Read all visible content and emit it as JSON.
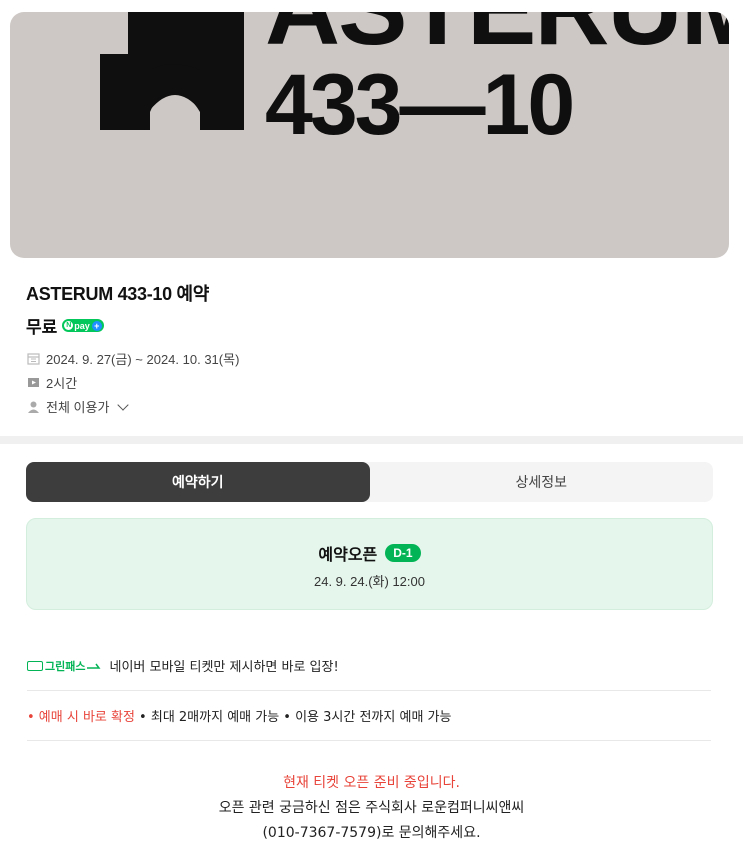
{
  "hero": {
    "line1": "ASTERUM",
    "line2": "433—10",
    "bg": "#cdc8c5"
  },
  "product": {
    "title": "ASTERUM 433-10 예약",
    "price": "무료",
    "pay_badge": "pay",
    "date_icon": "calendar-icon",
    "date_range": "2024. 9. 27(금) ~ 2024. 10. 31(목)",
    "duration_icon": "clock-icon",
    "duration": "2시간",
    "age_icon": "person-icon",
    "age": "전체 이용가"
  },
  "tabs": [
    {
      "label": "예약하기",
      "active": true
    },
    {
      "label": "상세정보",
      "active": false
    }
  ],
  "open": {
    "label": "예약오픈",
    "dday": "D-1",
    "datetime": "24. 9. 24.(화) 12:00"
  },
  "greenpass": {
    "badge": "그린패스",
    "text": "네이버 모바일 티켓만 제시하면 바로 입장!"
  },
  "notes": {
    "red": "• 예매 시 바로 확정",
    "rest": " • 최대 2매까지 예매 가능 • 이용 3시간 전까지 예매 가능"
  },
  "bottom": {
    "line1": "현재 티켓 오픈 준비 중입니다.",
    "line2": "오픈 관련 궁금하신 점은 주식회사 로운컴퍼니씨앤씨",
    "line3": "(010-7367-7579)로 문의해주세요."
  },
  "colors": {
    "accent_green": "#03b456",
    "alert_red": "#e8443a",
    "tab_active": "#3d3d3d"
  }
}
